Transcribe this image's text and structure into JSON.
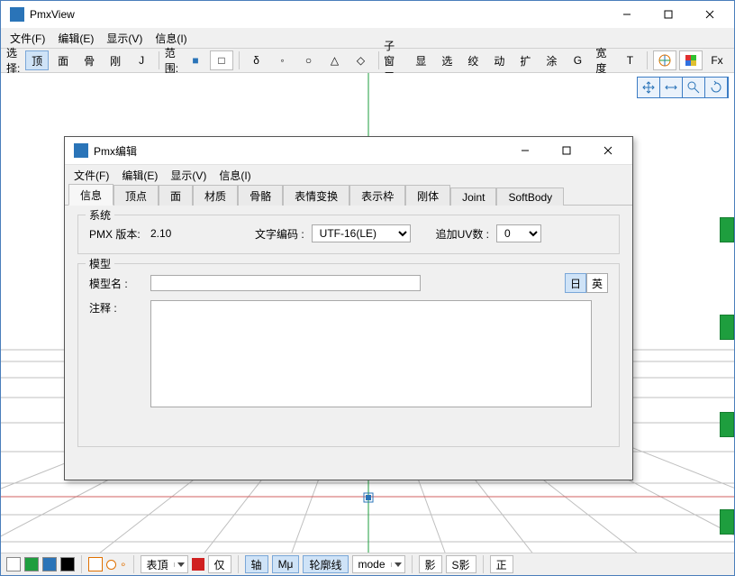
{
  "main": {
    "title": "PmxView",
    "menu": {
      "file": "文件(F)",
      "edit": "编辑(E)",
      "view": "显示(V)",
      "info": "信息(I)"
    },
    "toolbar": {
      "select_label": "选择:",
      "sel": {
        "v": "顶",
        "f": "面",
        "b": "骨",
        "r": "刚",
        "j": "J"
      },
      "range_label": "范围:",
      "range": {
        "dot": "■",
        "rect": "□",
        "delta": "δ",
        "mid": "◦",
        "circ": "○",
        "tri": "△",
        "rhom": "◇"
      },
      "subwin_label": "子窗口:",
      "sub": {
        "a": "显",
        "b": "选",
        "c": "绞",
        "d": "动",
        "e": "扩",
        "f": "涂",
        "g": "G",
        "w": "宽度",
        "t": "T"
      },
      "fx": "Fx"
    },
    "bottom": {
      "surface": "表頂",
      "only": "仅",
      "axis": "轴",
      "mu": "Mμ",
      "outline": "轮廓线",
      "mode": "mode",
      "shadow": "影",
      "sshadow": "S影",
      "ortho": "正"
    }
  },
  "child": {
    "title": "Pmx编辑",
    "menu": {
      "file": "文件(F)",
      "edit": "编辑(E)",
      "view": "显示(V)",
      "info": "信息(I)"
    },
    "tabs": {
      "info": "信息",
      "vert": "顶点",
      "face": "面",
      "mat": "材质",
      "bone": "骨骼",
      "morph": "表情变换",
      "frame": "表示枠",
      "rigid": "刚体",
      "joint": "Joint",
      "soft": "SoftBody"
    },
    "system": {
      "group": "系统",
      "pmx_label": "PMX 版本:",
      "pmx_ver": "2.10",
      "enc_label": "文字编码 :",
      "enc_val": "UTF-16(LE)",
      "uv_label": "追加UV数 :",
      "uv_val": "0"
    },
    "model": {
      "group": "模型",
      "name_label": "模型名 :",
      "name_val": "",
      "comment_label": "注释 :",
      "comment_val": "",
      "lang_jp": "日",
      "lang_en": "英"
    }
  }
}
